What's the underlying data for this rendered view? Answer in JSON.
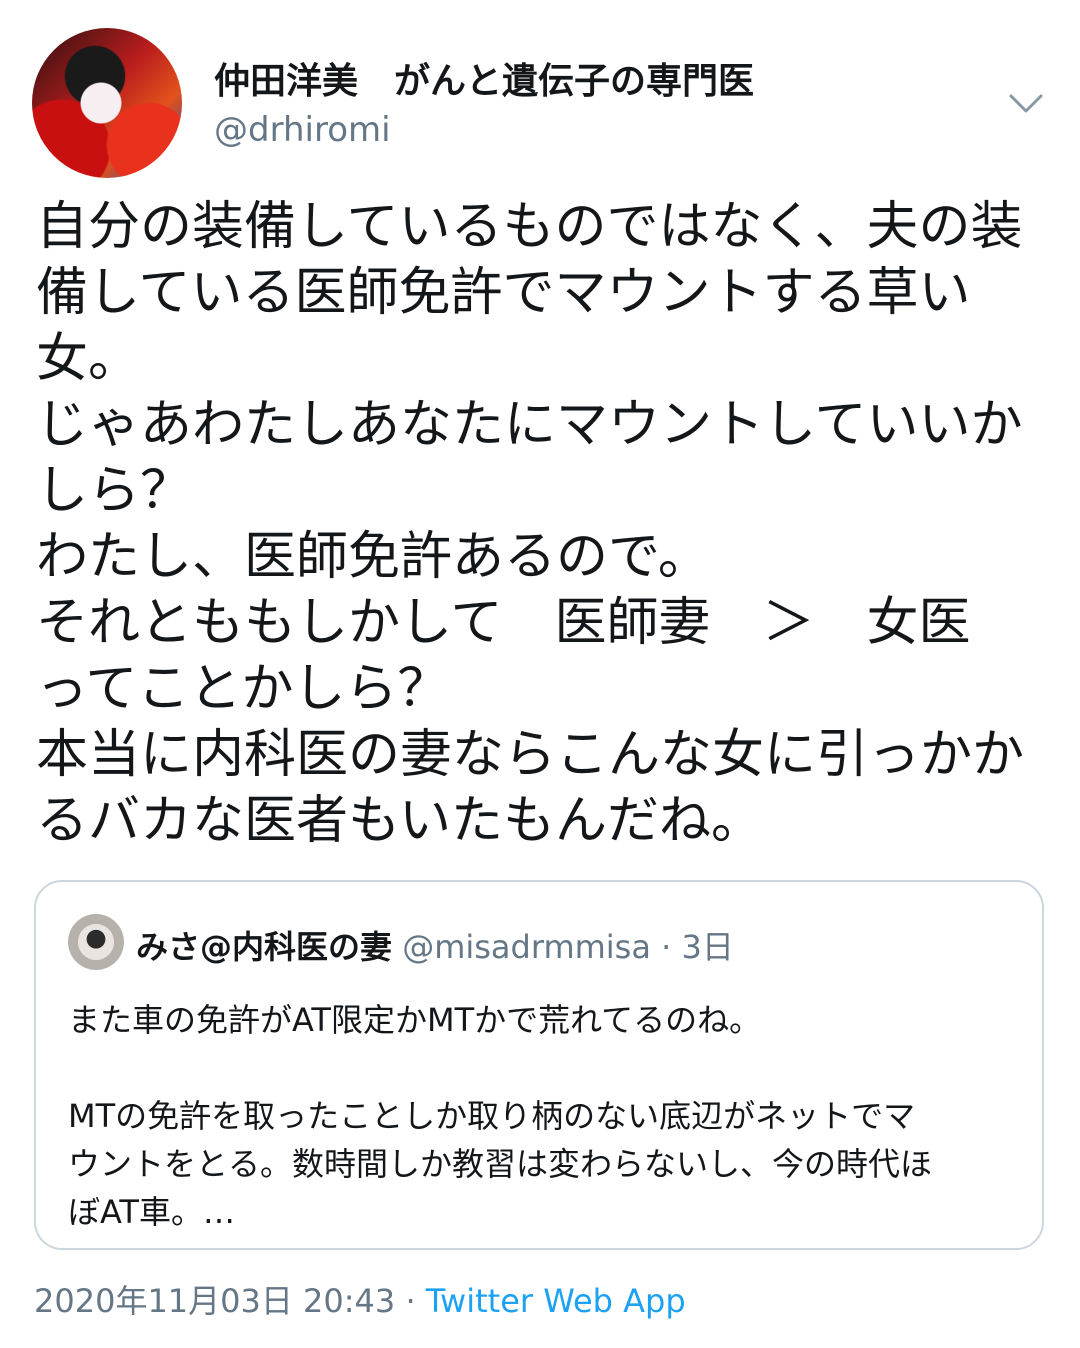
{
  "author": {
    "name": "仲田洋美　がんと遺伝子の専門医",
    "handle": "@drhiromi"
  },
  "tweet": {
    "lines": [
      "自分の装備しているものではなく、夫の装",
      "備している医師免許でマウントする草い",
      "女。",
      "じゃあわたしあなたにマウントしていいか",
      "しら？",
      "わたし、医師免許あるので。",
      "それとももしかして　医師妻　＞　女医",
      "ってことかしら？",
      "本当に内科医の妻ならこんな女に引っかか",
      "るバカな医者もいたもんだね。"
    ]
  },
  "quote": {
    "name": "みさ@内科医の妻",
    "handle": "@misadrmmisa",
    "time": "3日",
    "lines": [
      "また車の免許がAT限定かMTかで荒れてるのね。",
      "",
      "MTの免許を取ったことしか取り柄のない底辺がネットでマ",
      "ウントをとる。数時間しか教習は変わらないし、今の時代ほ",
      "ぼAT車。…"
    ]
  },
  "footer": {
    "timestamp": "2020年11月03日 20:43",
    "separator": "·",
    "source": "Twitter Web App"
  },
  "icons": {
    "menu": "chevron-down-icon"
  },
  "colors": {
    "text": "#14171a",
    "secondary": "#657786",
    "link": "#1da1f2",
    "border": "#ccd6dd"
  }
}
